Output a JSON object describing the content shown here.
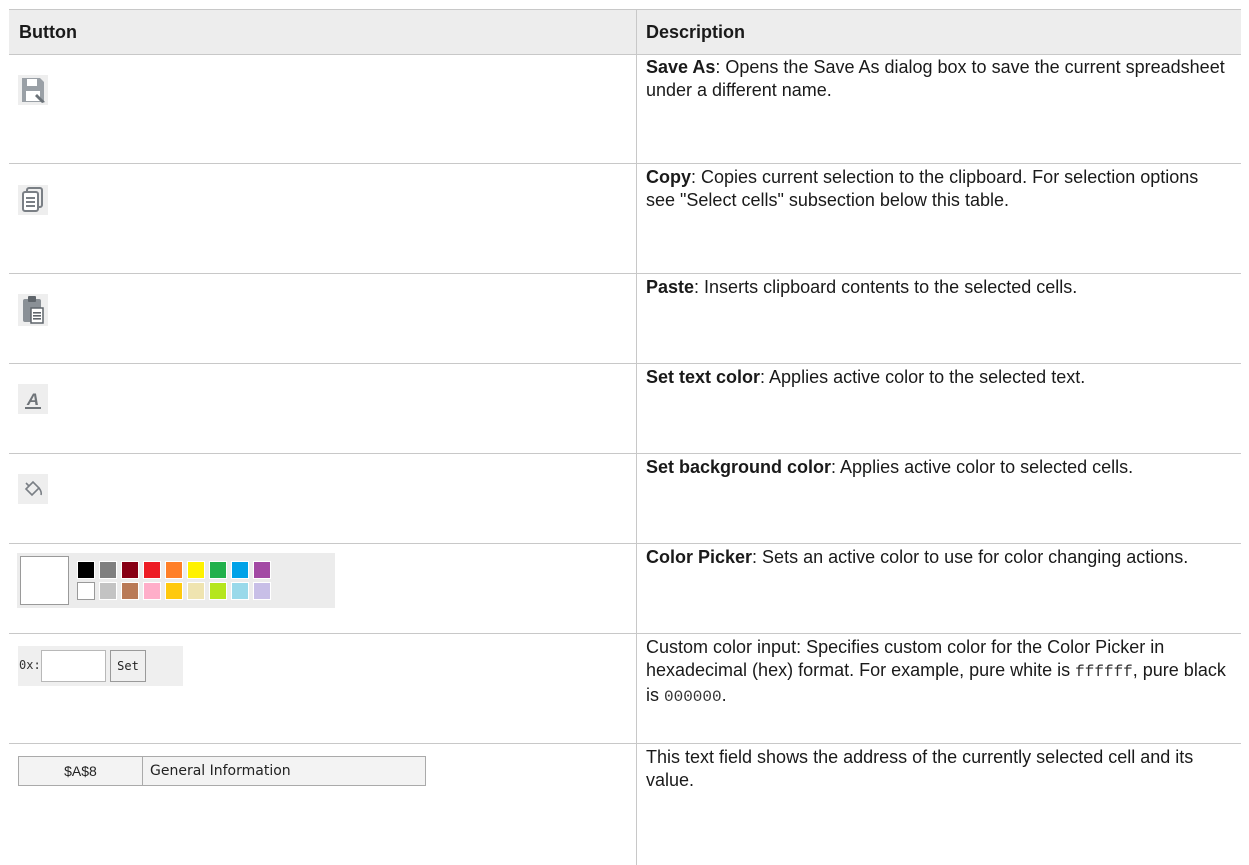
{
  "table": {
    "headers": {
      "button": "Button",
      "description": "Description"
    },
    "rows": [
      {
        "icon": "save-as-icon",
        "title": "Save As",
        "text": ": Opens the Save As dialog box to save the current spreadsheet under a different name."
      },
      {
        "icon": "copy-icon",
        "title": "Copy",
        "text": ": Copies current selection to the clipboard. For selection options see \"Select cells\" subsection below this table."
      },
      {
        "icon": "paste-icon",
        "title": "Paste",
        "text": ": Inserts clipboard contents to the selected cells."
      },
      {
        "icon": "text-color-icon",
        "title": "Set text color",
        "text": ": Applies active color to the selected text."
      },
      {
        "icon": "background-color-icon",
        "title": "Set background color",
        "text": ": Applies active color to selected cells."
      },
      {
        "icon": "color-picker-palette",
        "title": "Color Picker",
        "text": ": Sets an active color to use for color changing actions."
      },
      {
        "icon": "custom-color-input",
        "text_before": "Custom color input: Specifies custom color for the Color Picker in hexadecimal (hex) format. For example, pure white is ",
        "code_white": "ffffff",
        "text_middle": ", pure black is ",
        "code_black": "000000",
        "text_after": "."
      },
      {
        "icon": "cell-address-field",
        "text": "This text field shows the address of the currently selected cell and its value."
      }
    ]
  },
  "palette": {
    "top_row": [
      "#000000",
      "#7f7f7f",
      "#880015",
      "#ed1c24",
      "#ff7f27",
      "#fff200",
      "#22b14c",
      "#00a2e8",
      "#a349a4"
    ],
    "bottom_row": [
      "#ffffff",
      "#c3c3c3",
      "#b97a57",
      "#ffaec9",
      "#ffc90e",
      "#efe4b0",
      "#b5e61d",
      "#99d9ea",
      "#c8bfe7"
    ]
  },
  "hex_input": {
    "label": "0x:",
    "value": "",
    "set_label": "Set"
  },
  "address_bar": {
    "address": "$A$8",
    "value": "General Information"
  }
}
